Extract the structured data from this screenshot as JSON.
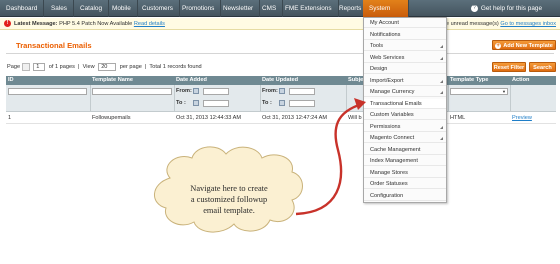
{
  "nav": {
    "items": [
      "Dashboard",
      "Sales",
      "Catalog",
      "Mobile",
      "Customers",
      "Promotions",
      "Newsletter",
      "CMS",
      "FME Extensions",
      "Reports",
      "System"
    ],
    "active": "System",
    "help": "Get help for this page"
  },
  "message": {
    "label": "Latest Message:",
    "text": "PHP 5.4 Patch Now Available",
    "link": "Read details",
    "right_text": "notice unread message(s)",
    "right_link": "Go to messages inbox"
  },
  "page": {
    "title": "Transactional Emails",
    "add_button": "Add New Template",
    "reset_button": "Reset Filter",
    "search_button": "Search"
  },
  "pager": {
    "page_label": "Page",
    "page_value": "1",
    "of_pages": "of 1 pages",
    "view_label": "View",
    "view_value": "20",
    "per_page": "per page",
    "total": "Total 1 records found"
  },
  "grid": {
    "headers": [
      "ID",
      "Template Name",
      "Date Added",
      "Date Updated",
      "Subje",
      "Template Type",
      "Action"
    ],
    "from_label": "From:",
    "to_label": "To :",
    "row": {
      "id": "1",
      "name": "Followupemails",
      "added": "Oct 31, 2013 12:44:33 AM",
      "updated": "Oct 31, 2013 12:47:24 AM",
      "subject": "Will b",
      "type": "HTML",
      "action": "Preview"
    }
  },
  "menu": {
    "items": [
      {
        "label": "My Account",
        "sub": false
      },
      {
        "label": "Notifications",
        "sub": false
      },
      {
        "label": "Tools",
        "sub": true
      },
      {
        "label": "Web Services",
        "sub": true
      },
      {
        "label": "Design",
        "sub": false
      },
      {
        "label": "Import/Export",
        "sub": true
      },
      {
        "label": "Manage Currency",
        "sub": true
      },
      {
        "label": "Transactional Emails",
        "sub": false
      },
      {
        "label": "Custom Variables",
        "sub": false
      },
      {
        "label": "Permissions",
        "sub": true
      },
      {
        "label": "Magento Connect",
        "sub": true
      },
      {
        "label": "Cache Management",
        "sub": false
      },
      {
        "label": "Index Management",
        "sub": false
      },
      {
        "label": "Manage Stores",
        "sub": false
      },
      {
        "label": "Order Statuses",
        "sub": false
      },
      {
        "label": "Configuration",
        "sub": false
      }
    ]
  },
  "callout": {
    "line1": "Navigate here to create",
    "line2": "a customized followup",
    "line3": "email template."
  },
  "colors": {
    "accent": "#eb5e00",
    "nav": "#4f616c",
    "arrow": "#c8322a"
  }
}
